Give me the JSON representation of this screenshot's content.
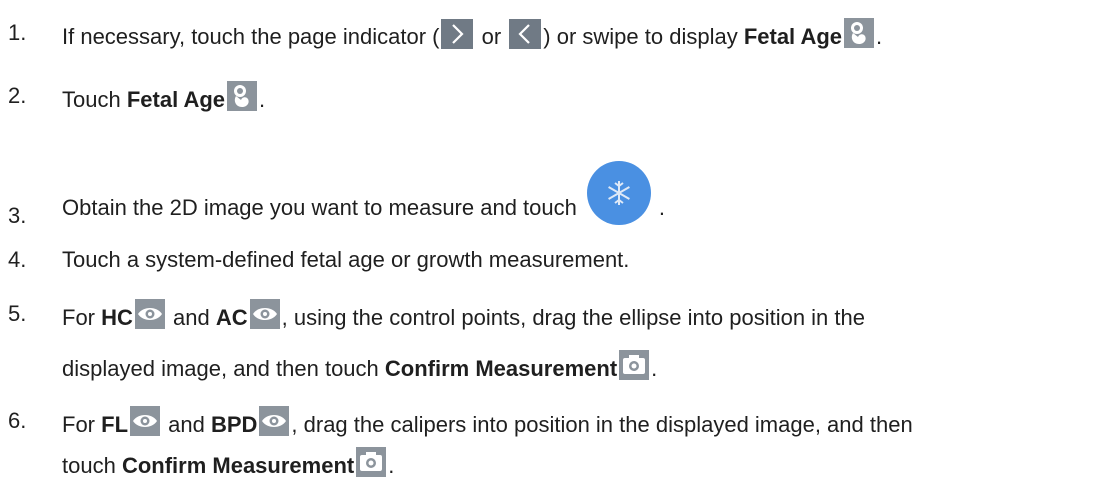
{
  "steps": [
    {
      "num": "1.",
      "parts": {
        "a": "If necessary, touch the page indicator (",
        "b": " or ",
        "c": ") or swipe to display ",
        "d": "Fetal Age",
        "e": "."
      }
    },
    {
      "num": "2.",
      "parts": {
        "a": "Touch ",
        "b": "Fetal Age",
        "c": "."
      }
    },
    {
      "num": "3.",
      "parts": {
        "a": "Obtain the 2D image you want to measure and touch",
        "b": "."
      }
    },
    {
      "num": "4.",
      "parts": {
        "a": "Touch a system-defined fetal age or growth measurement."
      }
    },
    {
      "num": "5.",
      "parts": {
        "a": "For ",
        "b": "HC",
        "c": " and ",
        "d": "AC",
        "e": ", using the control points, drag the ellipse into position in the",
        "f": "displayed image, and then touch ",
        "g": "Confirm Measurement",
        "h": "."
      }
    },
    {
      "num": "6.",
      "parts": {
        "a": "For ",
        "b": "FL",
        "c": " and ",
        "d": "BPD",
        "e": ", drag the calipers into position in the displayed image, and then",
        "f": "touch ",
        "g": "Confirm Measurement",
        "h": "."
      }
    }
  ],
  "icons": {
    "next_page": "chevron-right-icon",
    "prev_page": "chevron-left-icon",
    "fetal_age": "fetus-icon",
    "freeze": "snowflake-icon",
    "measure_eye": "eye-icon",
    "confirm": "camera-icon"
  },
  "colors": {
    "freeze_button": "#4a90e2",
    "nav_icon_bg": "#707a85",
    "tool_icon_bg": "#8c949c"
  }
}
